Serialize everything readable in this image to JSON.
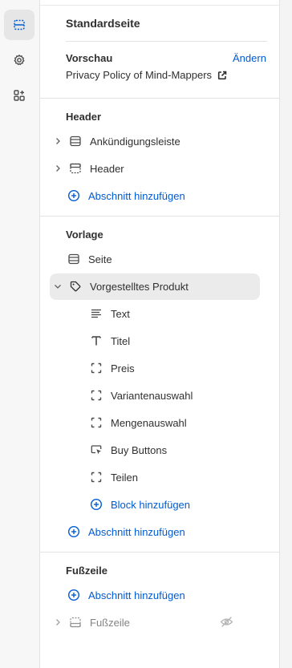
{
  "sidebar": {
    "sections_icon": "sections-icon",
    "settings_icon": "gear-icon",
    "apps_icon": "apps-icon"
  },
  "header": {
    "page_title": "Standardseite",
    "preview_label": "Vorschau",
    "change_link": "Ändern",
    "preview_page": "Privacy Policy of Mind-Mappers"
  },
  "groups": {
    "header_group": {
      "title": "Header",
      "items": [
        {
          "label": "Ankündigungsleiste",
          "icon": "layout-section-icon"
        },
        {
          "label": "Header",
          "icon": "layout-header-icon"
        }
      ],
      "add_section": "Abschnitt hinzufügen"
    },
    "template_group": {
      "title": "Vorlage",
      "page_item": "Seite",
      "product_section": "Vorgestelltes Produkt",
      "blocks": [
        {
          "label": "Text",
          "icon": "text-lines-icon"
        },
        {
          "label": "Titel",
          "icon": "title-t-icon"
        },
        {
          "label": "Preis",
          "icon": "dashed-box-icon"
        },
        {
          "label": "Variantenauswahl",
          "icon": "dashed-box-icon"
        },
        {
          "label": "Mengenauswahl",
          "icon": "dashed-box-icon"
        },
        {
          "label": "Buy Buttons",
          "icon": "button-cursor-icon"
        },
        {
          "label": "Teilen",
          "icon": "dashed-box-icon"
        }
      ],
      "add_block": "Block hinzufügen",
      "add_section": "Abschnitt hinzufügen"
    },
    "footer_group": {
      "title": "Fußzeile",
      "add_section": "Abschnitt hinzufügen",
      "footer_item": "Fußzeile"
    }
  },
  "colors": {
    "link": "#005bd3",
    "text": "#303030",
    "selected_bg": "#ebebeb"
  }
}
